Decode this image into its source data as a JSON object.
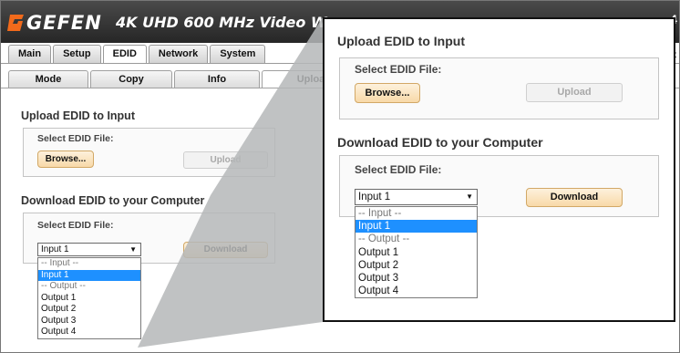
{
  "header": {
    "brand": "GEFEN",
    "title": "4K UHD 600 MHz Video W",
    "edge_char": "4",
    "edge_small": "it"
  },
  "main_tabs": [
    {
      "label": "Main"
    },
    {
      "label": "Setup"
    },
    {
      "label": "EDID"
    },
    {
      "label": "Network"
    },
    {
      "label": "System"
    }
  ],
  "sub_tabs": [
    {
      "label": "Mode"
    },
    {
      "label": "Copy"
    },
    {
      "label": "Info"
    },
    {
      "label": "Upload/D"
    }
  ],
  "upload": {
    "title": "Upload EDID to Input",
    "label": "Select EDID File:",
    "browse": "Browse...",
    "upload": "Upload"
  },
  "download": {
    "title": "Download EDID to your Computer",
    "label": "Select EDID File:",
    "selected": "Input 1",
    "arrow": "▼",
    "button": "Download"
  },
  "dropdown": [
    {
      "label": "-- Input --",
      "type": "group"
    },
    {
      "label": "Input 1",
      "type": "selected"
    },
    {
      "label": "-- Output --",
      "type": "group"
    },
    {
      "label": "Output 1",
      "type": "option"
    },
    {
      "label": "Output 2",
      "type": "option"
    },
    {
      "label": "Output 3",
      "type": "option"
    },
    {
      "label": "Output 4",
      "type": "option"
    }
  ],
  "colors": {
    "accent_orange": "#f26a1b",
    "selection_blue": "#1e90ff",
    "button_orange": "#f8d9a8"
  }
}
